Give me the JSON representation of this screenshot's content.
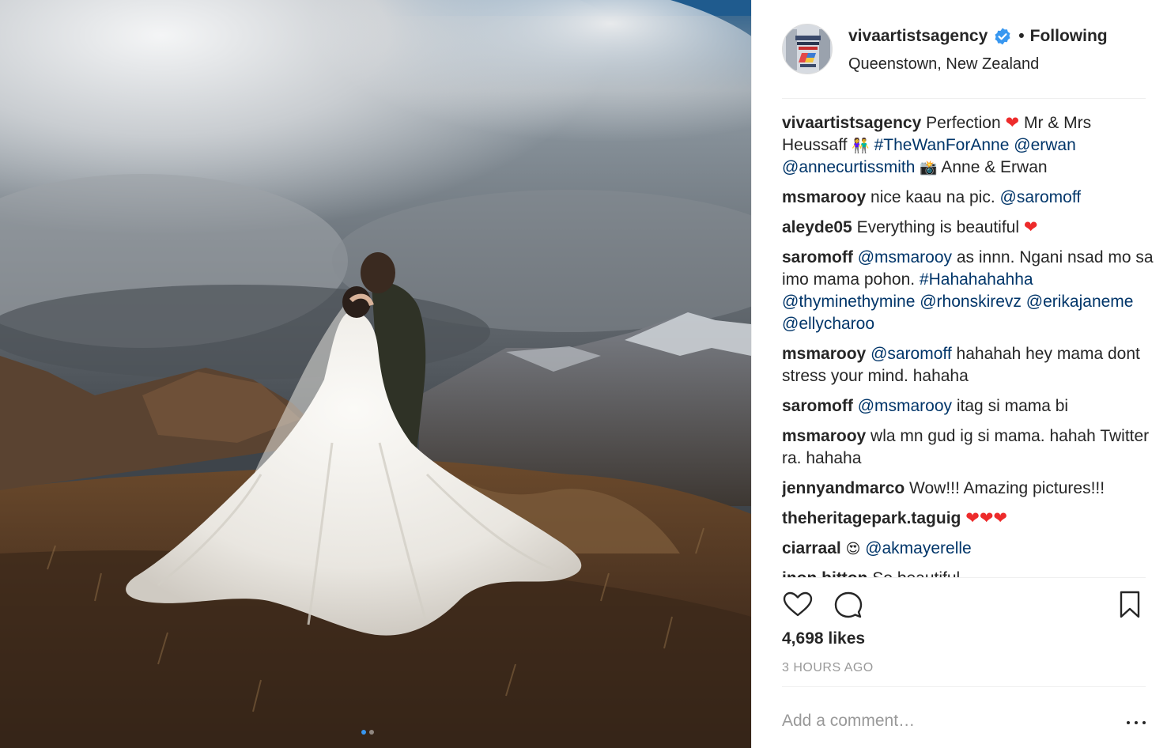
{
  "post": {
    "username": "vivaartistsagency",
    "verified": true,
    "follow_status": "Following",
    "separator": "•",
    "location": "Queenstown, New Zealand"
  },
  "comments": [
    {
      "user": "vivaartistsagency",
      "parts": [
        {
          "t": "text",
          "v": " Perfection "
        },
        {
          "t": "heart",
          "v": "❤"
        },
        {
          "t": "text",
          "v": " Mr & Mrs Heussaff "
        },
        {
          "t": "emoji",
          "v": "👫"
        },
        {
          "t": "text",
          "v": " "
        },
        {
          "t": "link",
          "v": "#TheWanForAnne"
        },
        {
          "t": "text",
          "v": " "
        },
        {
          "t": "link",
          "v": "@erwan"
        },
        {
          "t": "text",
          "v": " "
        },
        {
          "t": "link",
          "v": "@annecurtissmith"
        },
        {
          "t": "text",
          "v": " "
        },
        {
          "t": "emoji",
          "v": "📸"
        },
        {
          "t": "text",
          "v": " Anne & Erwan"
        }
      ]
    },
    {
      "user": "msmarooy",
      "parts": [
        {
          "t": "text",
          "v": " nice kaau na pic. "
        },
        {
          "t": "link",
          "v": "@saromoff"
        }
      ]
    },
    {
      "user": "aleyde05",
      "parts": [
        {
          "t": "text",
          "v": " Everything is beautiful "
        },
        {
          "t": "heart",
          "v": "❤"
        }
      ]
    },
    {
      "user": "saromoff",
      "parts": [
        {
          "t": "text",
          "v": " "
        },
        {
          "t": "link",
          "v": "@msmarooy"
        },
        {
          "t": "text",
          "v": " as innn. Ngani nsad mo sa imo mama pohon. "
        },
        {
          "t": "link",
          "v": "#Hahahahahha"
        },
        {
          "t": "text",
          "v": " "
        },
        {
          "t": "link",
          "v": "@thyminethymine"
        },
        {
          "t": "text",
          "v": " "
        },
        {
          "t": "link",
          "v": "@rhonskirevz"
        },
        {
          "t": "text",
          "v": " "
        },
        {
          "t": "link",
          "v": "@erikajaneme"
        },
        {
          "t": "text",
          "v": " "
        },
        {
          "t": "link",
          "v": "@ellycharoo"
        }
      ]
    },
    {
      "user": "msmarooy",
      "parts": [
        {
          "t": "text",
          "v": " "
        },
        {
          "t": "link",
          "v": "@saromoff"
        },
        {
          "t": "text",
          "v": " hahahah hey mama dont stress your mind. hahaha"
        }
      ]
    },
    {
      "user": "saromoff",
      "parts": [
        {
          "t": "text",
          "v": " "
        },
        {
          "t": "link",
          "v": "@msmarooy"
        },
        {
          "t": "text",
          "v": " itag si mama bi"
        }
      ]
    },
    {
      "user": "msmarooy",
      "parts": [
        {
          "t": "text",
          "v": " wla mn gud ig si mama. hahah Twitter ra. hahaha"
        }
      ]
    },
    {
      "user": "jennyandmarco",
      "parts": [
        {
          "t": "text",
          "v": " Wow!!! Amazing pictures!!!"
        }
      ]
    },
    {
      "user": "theheritagepark.taguig",
      "parts": [
        {
          "t": "text",
          "v": " "
        },
        {
          "t": "heart",
          "v": "❤❤❤"
        }
      ]
    },
    {
      "user": "ciarraal",
      "parts": [
        {
          "t": "text",
          "v": " "
        },
        {
          "t": "emoji",
          "v": "😍"
        },
        {
          "t": "text",
          "v": " "
        },
        {
          "t": "link",
          "v": "@akmayerelle"
        }
      ]
    },
    {
      "user": "inon.bitton",
      "parts": [
        {
          "t": "text",
          "v": " So beautiful"
        }
      ]
    }
  ],
  "actions": {
    "like_icon": "heart-outline-icon",
    "comment_icon": "speech-bubble-icon",
    "save_icon": "bookmark-icon"
  },
  "likes": "4,698 likes",
  "timestamp": "3 HOURS AGO",
  "add_comment": {
    "placeholder": "Add a comment…",
    "value": ""
  },
  "colors": {
    "link": "#003569",
    "verified": "#3897f0",
    "muted": "#999999",
    "text": "#262626",
    "heart": "#ed2b2b"
  }
}
